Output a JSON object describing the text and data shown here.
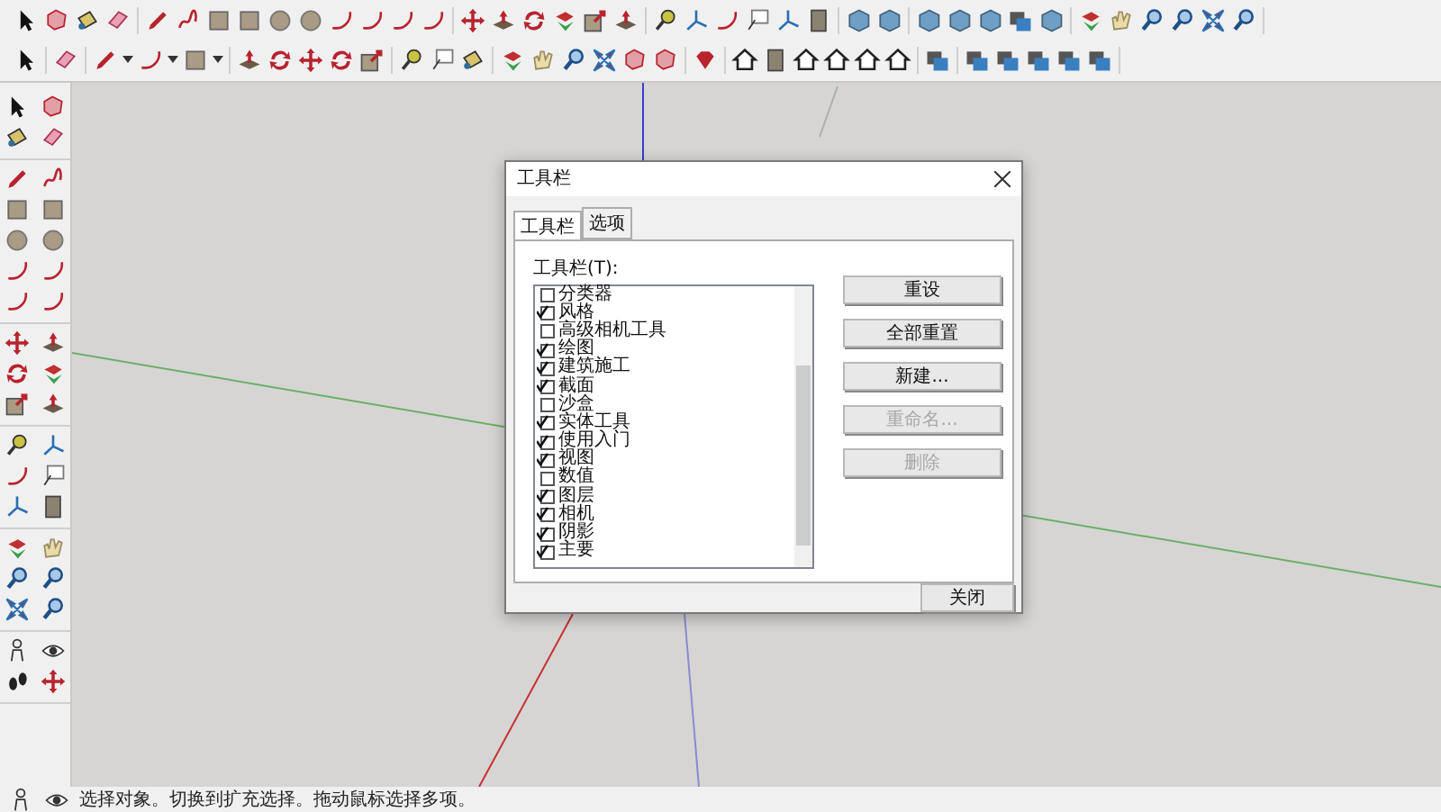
{
  "toolbars_dialog": {
    "title": "工具栏",
    "tabs": [
      {
        "label": "工具栏",
        "selected": true
      },
      {
        "label": "选项",
        "selected": false
      }
    ],
    "list_label": "工具栏(T):",
    "items": [
      {
        "label": "分类器",
        "checked": false
      },
      {
        "label": "风格",
        "checked": true
      },
      {
        "label": "高级相机工具",
        "checked": false
      },
      {
        "label": "绘图",
        "checked": true
      },
      {
        "label": "建筑施工",
        "checked": true
      },
      {
        "label": "截面",
        "checked": true
      },
      {
        "label": "沙盒",
        "checked": false
      },
      {
        "label": "实体工具",
        "checked": true
      },
      {
        "label": "使用入门",
        "checked": true
      },
      {
        "label": "视图",
        "checked": true
      },
      {
        "label": "数值",
        "checked": false
      },
      {
        "label": "图层",
        "checked": true
      },
      {
        "label": "相机",
        "checked": true
      },
      {
        "label": "阴影",
        "checked": true
      },
      {
        "label": "主要",
        "checked": true
      }
    ],
    "buttons": [
      {
        "label": "重设",
        "disabled": false
      },
      {
        "label": "全部重置",
        "disabled": false
      },
      {
        "label": "新建...",
        "disabled": false
      },
      {
        "label": "重命名...",
        "disabled": true
      },
      {
        "label": "删除",
        "disabled": true
      }
    ],
    "close_button": "关闭"
  },
  "status_bar": {
    "text": "选择对象。切换到扩充选择。拖动鼠标选择多项。"
  }
}
